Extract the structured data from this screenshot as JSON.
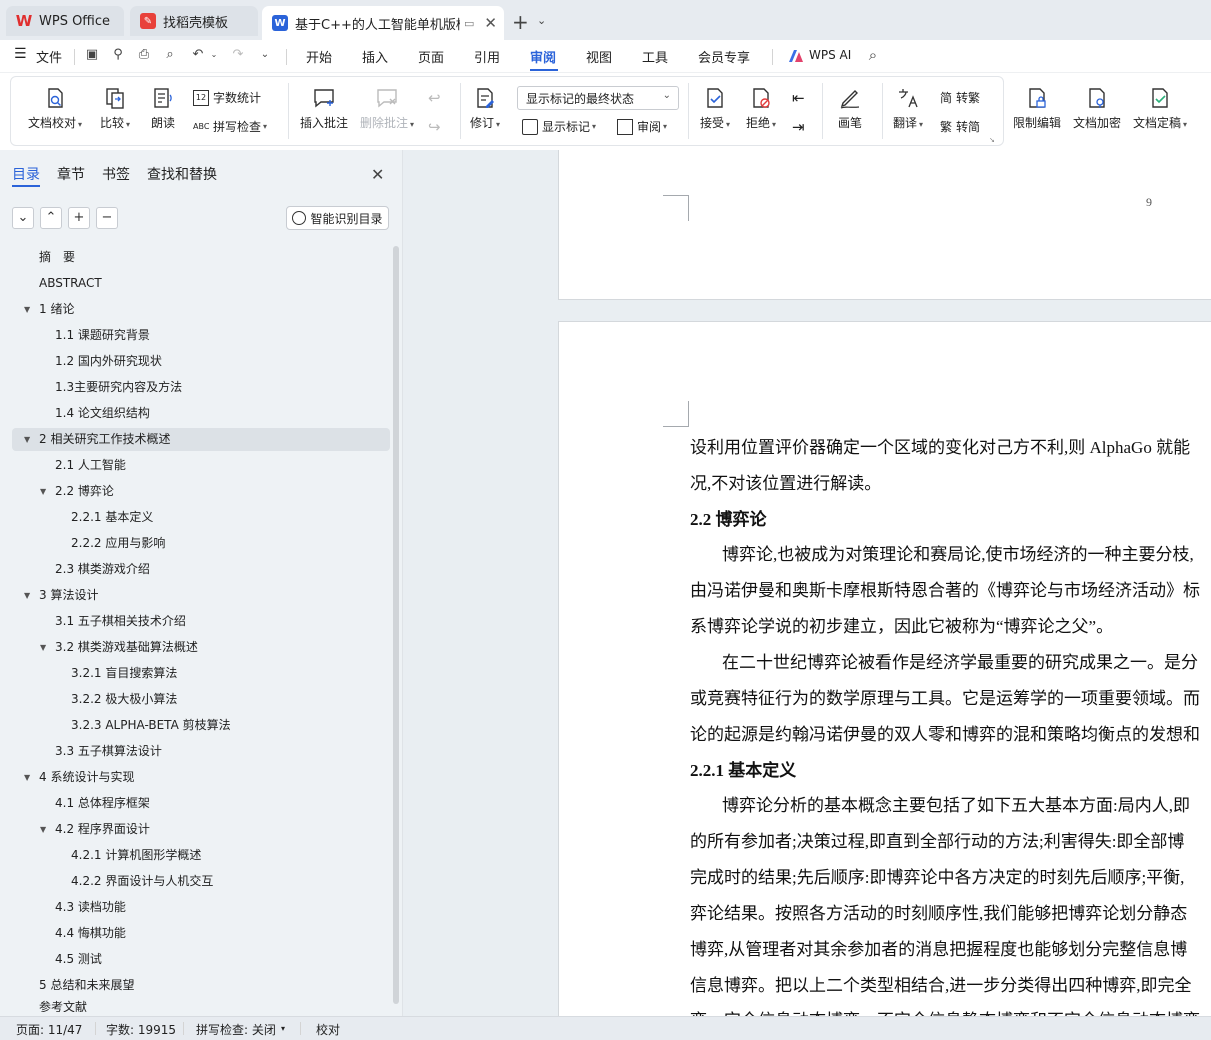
{
  "tabs": [
    {
      "label": "WPS Office"
    },
    {
      "label": "找稻壳模板"
    },
    {
      "label": "基于C++的人工智能单机版棋"
    }
  ],
  "menu": {
    "file": "文件",
    "items": [
      "开始",
      "插入",
      "页面",
      "引用",
      "审阅",
      "视图",
      "工具",
      "会员专享"
    ],
    "wps_ai": "WPS AI"
  },
  "ribbon": {
    "doc_proofread": "文档校对",
    "compare": "比较",
    "read_aloud": "朗读",
    "word_count": "字数统计",
    "spell_check": "拼写检查",
    "insert_comment": "插入批注",
    "delete_comment": "删除批注",
    "track_changes": "修订",
    "display_state": "显示标记的最终状态",
    "show_markup": "显示标记",
    "review": "审阅",
    "accept": "接受",
    "reject": "拒绝",
    "pen": "画笔",
    "translate": "翻译",
    "to_traditional": "转繁",
    "to_simplified": "转简",
    "restrict_editing": "限制编辑",
    "encrypt_doc": "文档加密",
    "finalize_doc": "文档定稿"
  },
  "nav": {
    "tabs": [
      "目录",
      "章节",
      "书签",
      "查找和替换"
    ],
    "smart_toc": "智能识别目录",
    "toc": [
      {
        "label": "摘　要"
      },
      {
        "label": "ABSTRACT"
      },
      {
        "label": "1  绪论"
      },
      {
        "label": "1.1  课题研究背景"
      },
      {
        "label": "1.2  国内外研究现状"
      },
      {
        "label": "1.3主要研究内容及方法"
      },
      {
        "label": "1.4  论文组织结构"
      },
      {
        "label": "2  相关研究工作技术概述"
      },
      {
        "label": "2.1  人工智能"
      },
      {
        "label": "2.2  博弈论"
      },
      {
        "label": "2.2.1  基本定义"
      },
      {
        "label": "2.2.2  应用与影响"
      },
      {
        "label": "2.3  棋类游戏介绍"
      },
      {
        "label": "3  算法设计"
      },
      {
        "label": "3.1  五子棋相关技术介绍"
      },
      {
        "label": "3.2  棋类游戏基础算法概述"
      },
      {
        "label": "3.2.1  盲目搜索算法"
      },
      {
        "label": "3.2.2  极大极小算法"
      },
      {
        "label": "3.2.3  ALPHA-BETA  剪枝算法"
      },
      {
        "label": "3.3  五子棋算法设计"
      },
      {
        "label": "4  系统设计与实现"
      },
      {
        "label": "4.1  总体程序框架"
      },
      {
        "label": "4.2  程序界面设计"
      },
      {
        "label": "4.2.1  计算机图形学概述"
      },
      {
        "label": "4.2.2  界面设计与人机交互"
      },
      {
        "label": "4.3  读档功能"
      },
      {
        "label": "4.4  悔棋功能"
      },
      {
        "label": "4.5  测试"
      },
      {
        "label": "5  总结和未来展望"
      },
      {
        "label": "参考文献"
      }
    ]
  },
  "document": {
    "prev_page_number": "9",
    "paragraphs": [
      "设利用位置评价器确定一个区域的变化对己方不利,则 AlphaGo 就能",
      "况,不对该位置进行解读。",
      "2.2  博弈论",
      "博弈论,也被成为对策理论和赛局论,使市场经济的一种主要分枝,",
      "由冯诺伊曼和奥斯卡摩根斯特恩合著的《博弈论与市场经济活动》标",
      "系博弈论学说的初步建立，因此它被称为“博弈论之父”。",
      "在二十世纪博弈论被看作是经济学最重要的研究成果之一。是分",
      "或竞赛特征行为的数学原理与工具。它是运筹学的一项重要领域。而",
      "论的起源是约翰冯诺伊曼的双人零和博弈的混和策略均衡点的发想和",
      "2.2.1 基本定义",
      "博弈论分析的基本概念主要包括了如下五大基本方面:局内人,即",
      "的所有参加者;决策过程,即直到全部行动的方法;利害得失:即全部博",
      "完成时的结果;先后顺序:即博弈论中各方决定的时刻先后顺序;平衡,",
      "弈论结果。按照各方活动的时刻顺序性,我们能够把博弈论划分静态",
      "博弈,从管理者对其余参加者的消息把握程度也能够划分完整信息博",
      "信息博弈。把以上二个类型相结合,进一步分类得出四种博弈,即完全",
      "弈、完全信息动态博弈、不完全信息静态博弈和不完全信息动态博弈"
    ]
  },
  "status": {
    "page": "页面: 11/47",
    "word_count": "字数: 19915",
    "spell_check": "拼写检查: 关闭",
    "proofread": "校对"
  }
}
